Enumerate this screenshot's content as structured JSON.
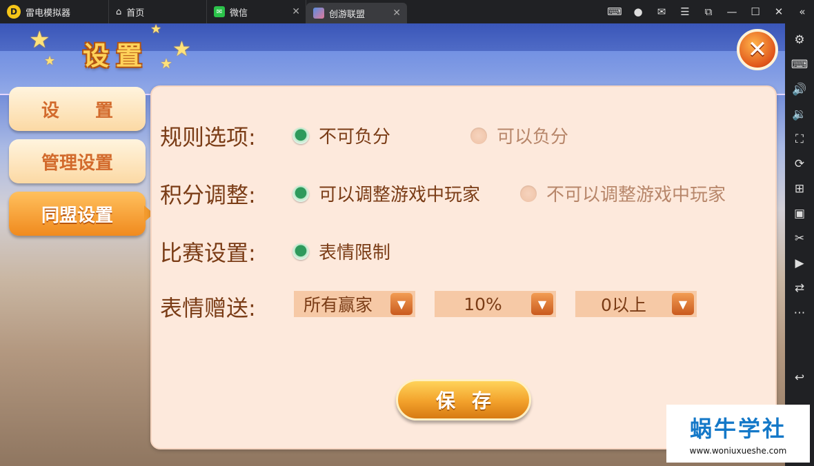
{
  "titlebar": {
    "app_name": "雷电模拟器",
    "tabs": [
      {
        "label": "首页"
      },
      {
        "label": "微信"
      },
      {
        "label": "创游联盟"
      }
    ]
  },
  "window_controls": [
    "gamepad-icon",
    "user-icon",
    "mail-icon",
    "menu-icon",
    "restore-icon",
    "minimize-icon",
    "maximize-icon",
    "close-icon",
    "collapse-icon"
  ],
  "right_sidebar": [
    "settings-icon",
    "keyboard-icon",
    "volume-up-icon",
    "volume-down-icon",
    "screenshot-icon",
    "sync-icon",
    "add-window-icon",
    "apk-icon",
    "scissors-icon",
    "record-icon",
    "swap-icon",
    "more-icon",
    "back-icon"
  ],
  "game": {
    "title": "设置",
    "menu": [
      {
        "label": "设　　置",
        "active": false
      },
      {
        "label": "管理设置",
        "active": false
      },
      {
        "label": "同盟设置",
        "active": true
      }
    ],
    "rows": {
      "rule": {
        "label": "规则选项:",
        "options": [
          {
            "label": "不可负分",
            "selected": true
          },
          {
            "label": "可以负分",
            "selected": false
          }
        ]
      },
      "score": {
        "label": "积分调整:",
        "options": [
          {
            "label": "可以调整游戏中玩家",
            "selected": true
          },
          {
            "label": "不可以调整游戏中玩家",
            "selected": false
          }
        ]
      },
      "match": {
        "label": "比赛设置:",
        "options": [
          {
            "label": "表情限制",
            "selected": true
          }
        ]
      },
      "gift": {
        "label": "表情赠送:",
        "dropdowns": [
          {
            "value": "所有赢家"
          },
          {
            "value": "10%"
          },
          {
            "value": "0以上"
          }
        ]
      }
    },
    "save_label": "保存"
  },
  "watermark": {
    "title": "蜗牛学社",
    "url": "www.woniuxueshe.com"
  }
}
